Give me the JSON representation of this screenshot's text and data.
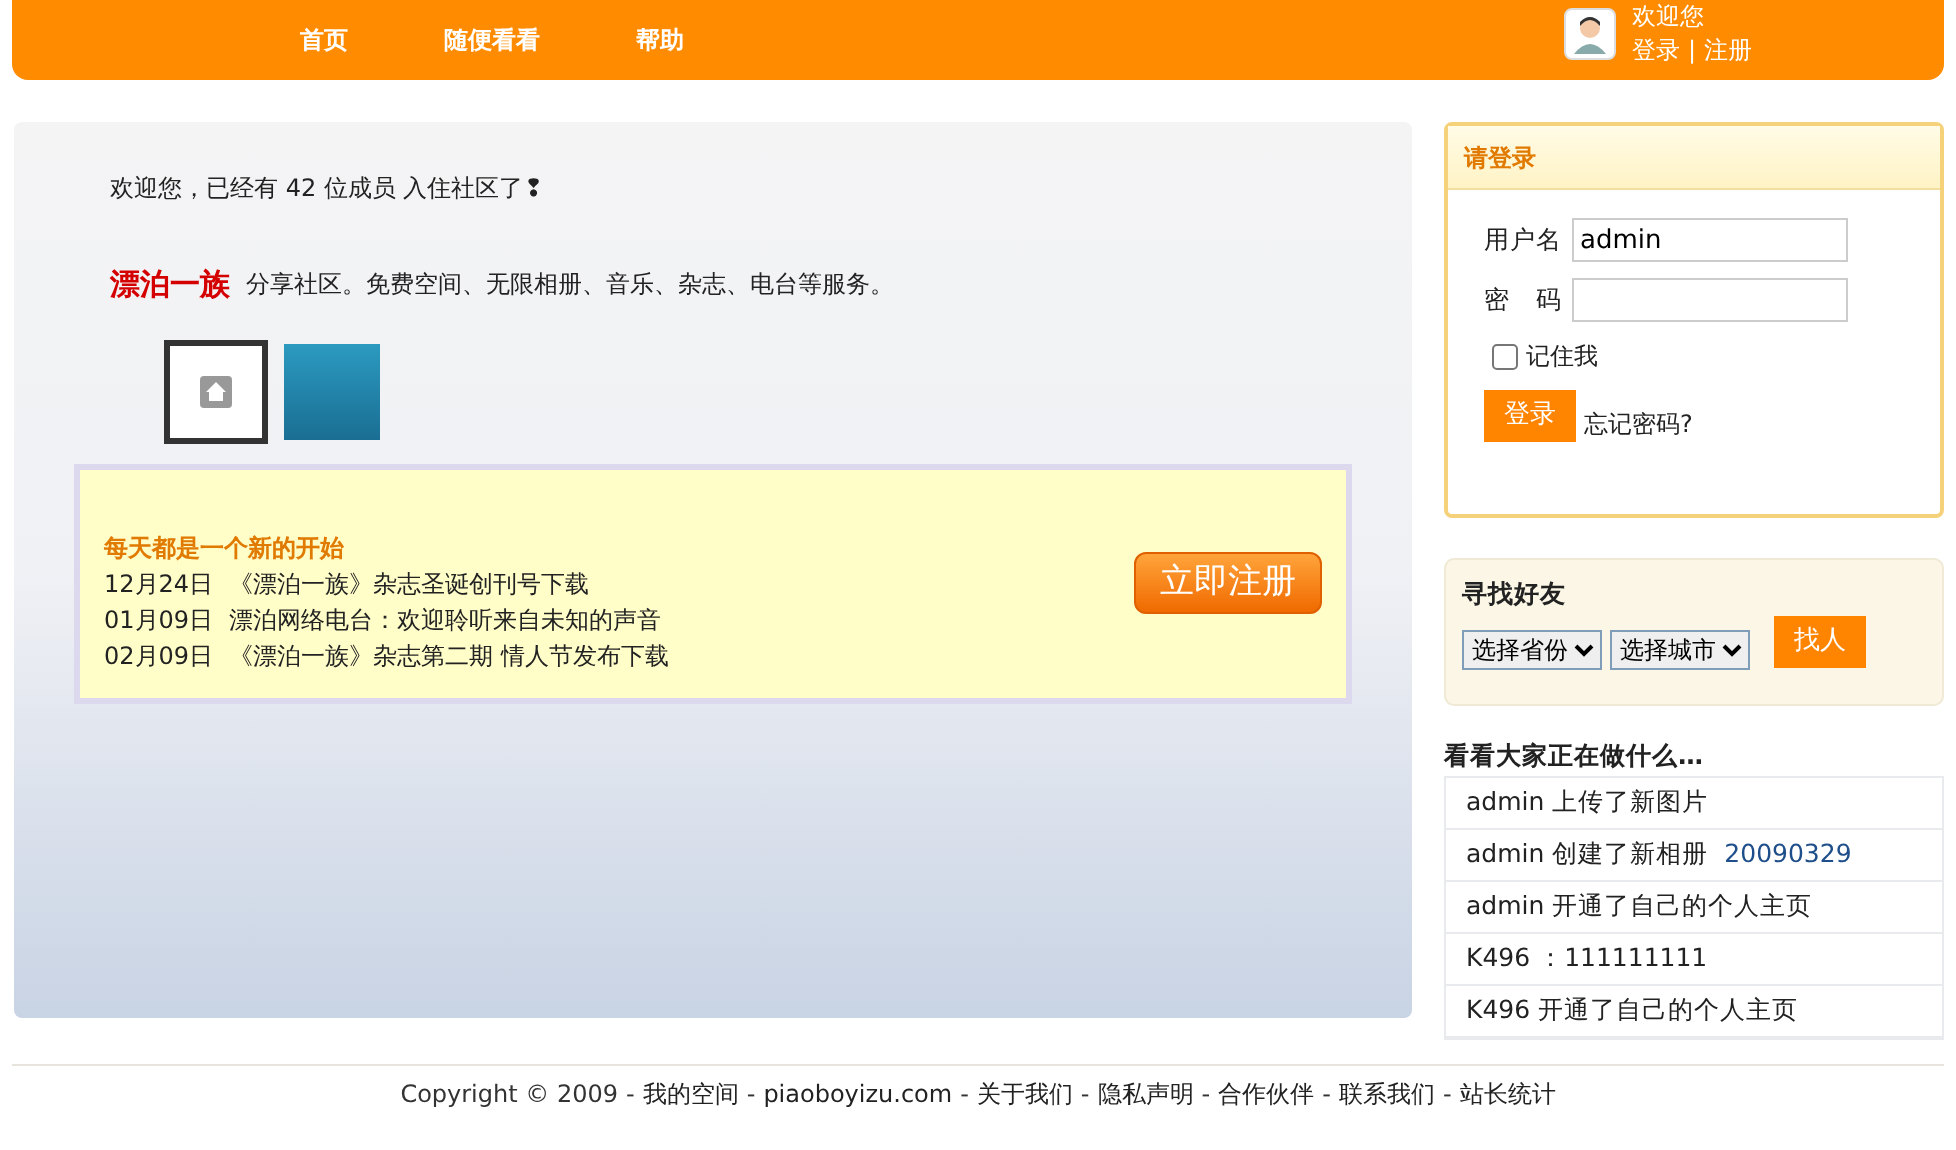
{
  "header": {
    "nav": [
      "首页",
      "随便看看",
      "帮助"
    ],
    "welcome": "欢迎您",
    "login": "登录",
    "separator": "|",
    "register": "注册"
  },
  "intro": {
    "before": "欢迎您，已经有",
    "members": "42 位成员",
    "after": "入住社区了❢",
    "brand": "漂泊一族",
    "tagline": "分享社区。免费空间、无限相册、音乐、杂志、电台等服务。"
  },
  "notice": {
    "title": "每天都是一个新的开始",
    "items": [
      {
        "date": "12月24日",
        "text": "《漂泊一族》杂志圣诞创刊号下载"
      },
      {
        "date": "01月09日",
        "text": "漂泊网络电台：欢迎聆听来自未知的声音"
      },
      {
        "date": "02月09日",
        "text": "《漂泊一族》杂志第二期 情人节发布下载"
      }
    ],
    "button": "立即注册"
  },
  "login_box": {
    "title": "请登录",
    "username_label": "用户名",
    "username": "admin",
    "password_label": "密　码",
    "remember": "记住我",
    "remember_checked": false,
    "submit": "登录",
    "forgot": "忘记密码?"
  },
  "find_friends": {
    "title": "寻找好友",
    "province": "选择省份",
    "city": "选择城市",
    "button": "找人"
  },
  "activity": {
    "title": "看看大家正在做什么…",
    "items": [
      {
        "user": "admin",
        "action": "上传了新图片"
      },
      {
        "user": "admin",
        "action": "创建了新相册",
        "link": "20090329"
      },
      {
        "user": "admin",
        "action": "开通了自己的个人主页"
      },
      {
        "user": "K496",
        "action": "：111111111"
      },
      {
        "user": "K496",
        "action": "开通了自己的个人主页"
      }
    ]
  },
  "footer": {
    "items": [
      "Copyright © 2009",
      "我的空间",
      "piaoboyizu.com",
      "关于我们",
      "隐私声明",
      "合作伙伴",
      "联系我们",
      "站长统计"
    ],
    "separator": "-"
  }
}
